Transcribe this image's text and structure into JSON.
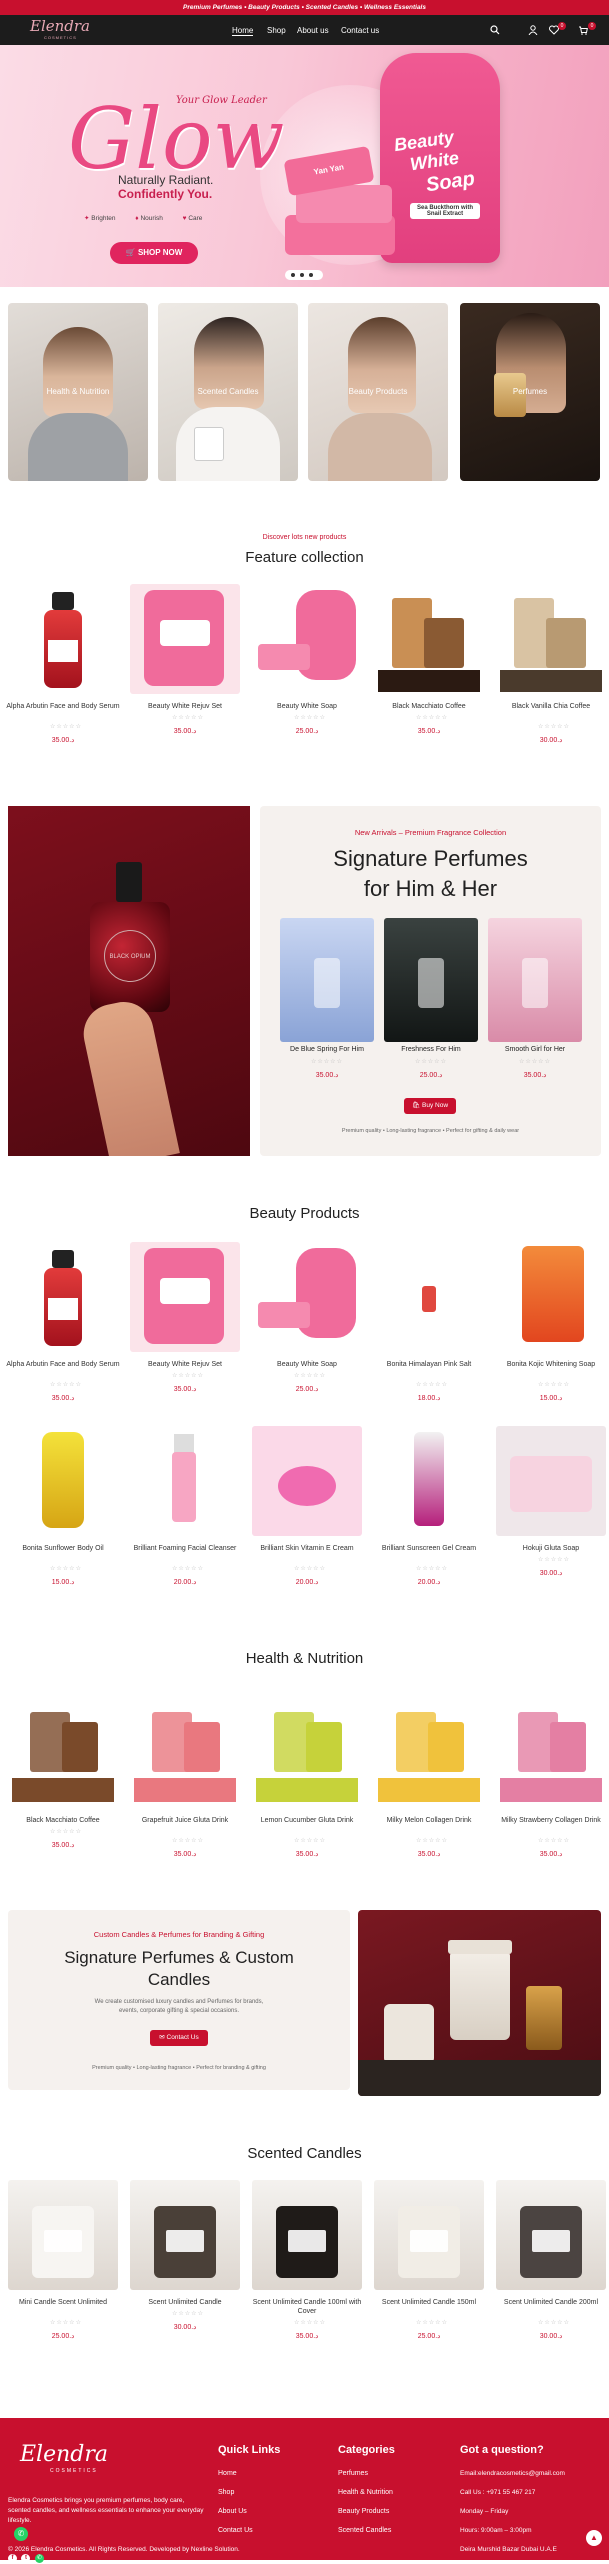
{
  "announcement": "Premium Perfumes • Beauty Products • Scented Candles • Wellness Essentials",
  "nav": {
    "logo": "Elendra",
    "logo_sub": "COSMETICS",
    "links": [
      "Home",
      "Shop",
      "About us",
      "Contact us"
    ],
    "wishlist_count": "0",
    "cart_count": "0"
  },
  "hero": {
    "script": "Your Glow Leader",
    "headline": "Glow",
    "tagline1": "Naturally Radiant.",
    "tagline2": "Confidently You.",
    "features": [
      "Brighten",
      "Nourish",
      "Care"
    ],
    "cta": "SHOP NOW",
    "product_text": [
      "Beauty",
      "White",
      "Soap"
    ],
    "product_sub": "Sea Buckthorn with Snail Extract",
    "soap_text": "Yan Yan"
  },
  "categories": [
    "Health & Nutrition",
    "Scented Candles",
    "Beauty Products",
    "Perfumes"
  ],
  "feature": {
    "subtitle": "Discover lots new products",
    "title": "Feature collection",
    "products": [
      {
        "name": "Alpha Arbutin Face and Body Serum",
        "price": "35.00.د",
        "label": "Alpha Arbutin",
        "img": "serum"
      },
      {
        "name": "Beauty White Rejuv Set",
        "price": "35.00.د",
        "label": "Rejuv Set",
        "img": "pinkbag"
      },
      {
        "name": "Beauty White Soap",
        "price": "25.00.د",
        "label": "Beauty White Soap",
        "img": "pinksoap"
      },
      {
        "name": "Black Macchiato Coffee",
        "price": "35.00.د",
        "label": "Black Macchiato Coffee",
        "img": "coffee"
      },
      {
        "name": "Black Vanilla Chia Coffee",
        "price": "30.00.د",
        "label": "Black Vanilla Chia Coffee",
        "img": "vanilla"
      }
    ]
  },
  "perfume_promo": {
    "subtitle": "New Arrivals – Premium Fragrance Collection",
    "title_line1": "Signature Perfumes",
    "title_line2": "for Him & Her",
    "bottle_label": "BLACK OPIUM",
    "products": [
      {
        "name": "De Blue Spring For Him",
        "price": "35.00.د"
      },
      {
        "name": "Freshness For Him",
        "price": "25.00.د"
      },
      {
        "name": "Smooth Girl for Her",
        "price": "35.00.د"
      }
    ],
    "cta": "Buy Now",
    "note": "Premium quality • Long-lasting fragrance • Perfect for gifting & daily wear"
  },
  "beauty": {
    "title": "Beauty Products",
    "products": [
      {
        "name": "Alpha Arbutin Face and Body Serum",
        "price": "35.00.د",
        "img": "serum"
      },
      {
        "name": "Beauty White Rejuv Set",
        "price": "35.00.د",
        "img": "pinkbag"
      },
      {
        "name": "Beauty White Soap",
        "price": "25.00.د",
        "img": "pinksoap"
      },
      {
        "name": "Bonita Himalayan Pink Salt",
        "price": "18.00.د",
        "img": "salt"
      },
      {
        "name": "Bonita Kojic Whitening Soap",
        "price": "15.00.د",
        "img": "kojic"
      },
      {
        "name": "Bonita Sunflower Body Oil",
        "price": "15.00.د",
        "img": "oil"
      },
      {
        "name": "Brilliant Foaming Facial Cleanser",
        "price": "20.00.د",
        "img": "cleanser"
      },
      {
        "name": "Brilliant Skin Vitamin E Cream",
        "price": "20.00.د",
        "img": "cream"
      },
      {
        "name": "Brilliant Sunscreen Gel Cream",
        "price": "20.00.د",
        "img": "sunscreen"
      },
      {
        "name": "Hokuji Gluta Soap",
        "price": "30.00.د",
        "img": "hokuji"
      }
    ]
  },
  "health": {
    "title": "Health & Nutrition",
    "products": [
      {
        "name": "Black Macchiato Coffee",
        "price": "35.00.د",
        "label": "Black Macchiato Coffee",
        "color": "#7a4a2a"
      },
      {
        "name": "Grapefruit Juice Gluta Drink",
        "price": "35.00.د",
        "label": "Grapefruit Juice Gluta Drink",
        "color": "#e9787f"
      },
      {
        "name": "Lemon Cucumber Gluta Drink",
        "price": "35.00.د",
        "label": "Lemon Cucumber Gluta Drink",
        "color": "#c6d23a"
      },
      {
        "name": "Milky Melon Collagen Drink",
        "price": "35.00.د",
        "label": "Milky Melon Collagen Drink",
        "color": "#f0c23c"
      },
      {
        "name": "Milky Strawberry Collagen Drink",
        "price": "35.00.د",
        "label": "Milky Strawberry Collagen Drink",
        "color": "#e47fa3"
      }
    ]
  },
  "custom": {
    "subtitle": "Custom Candles & Perfumes for Branding & Gifting",
    "title_line1": "Signature Perfumes & Custom",
    "title_line2": "Candles",
    "body": "We create customised luxury candles and Perfumes for brands, events, corporate gifting & special occasions.",
    "cta": "Contact Us",
    "note": "Premium quality • Long-lasting fragrance • Perfect for branding & gifting"
  },
  "candles": {
    "title": "Scented Candles",
    "products": [
      {
        "name": "Mini Candle Scent Unlimited",
        "price": "25.00.د"
      },
      {
        "name": "Scent Unlimited Candle",
        "price": "30.00.د"
      },
      {
        "name": "Scent Unlimited Candle 100ml with Cover",
        "price": "35.00.د"
      },
      {
        "name": "Scent Unlimited Candle 150ml",
        "price": "25.00.د"
      },
      {
        "name": "Scent Unlimited Candle 200ml",
        "price": "30.00.د"
      }
    ]
  },
  "footer": {
    "logo": "Elendra",
    "logo_sub": "COSMETICS",
    "about": "Elendra Cosmetics brings you premium perfumes, body care, scented candles, and wellness essentials to enhance your everyday lifestyle.",
    "quick_title": "Quick Links",
    "quick_links": [
      "Home",
      "Shop",
      "About Us",
      "Contact Us"
    ],
    "cat_title": "Categories",
    "cat_links": [
      "Perfumes",
      "Health & Nutrition",
      "Beauty Products",
      "Scented Candles"
    ],
    "q_title": "Got a question?",
    "contact": [
      "Email:elendracosmetics@gmail.com",
      "Call Us : +971 55 467 217",
      "Monday – Friday",
      "Hours: 9:00am – 3:00pm",
      "Deira Murshid Bazar Dubai U.A.E"
    ],
    "copyright": "© 2026 Elendra Cosmetics. All Rights Reserved. Developed by Nexline Solution."
  },
  "colors": {
    "brand_red": "#c8102e",
    "nav_dark": "#1c1c1c",
    "hero_pink": "#f6b1c8"
  }
}
